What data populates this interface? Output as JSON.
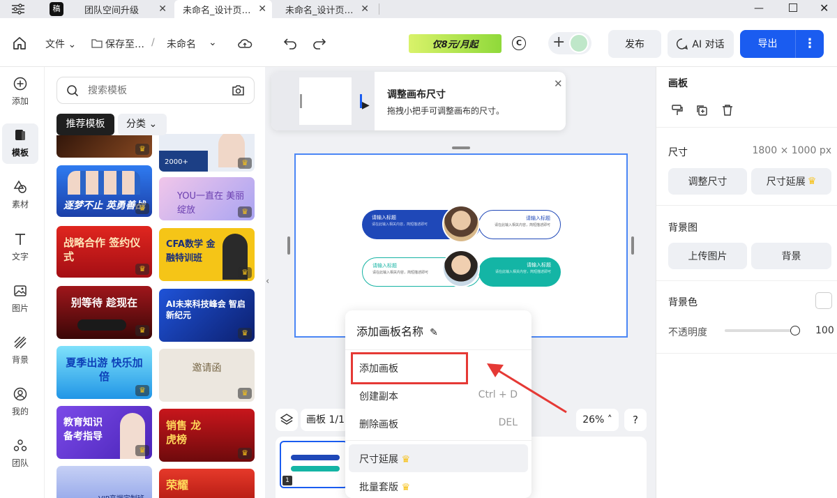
{
  "tabs": [
    {
      "label": "团队空间升级"
    },
    {
      "label": "未命名_设计页…"
    },
    {
      "label": "未命名_设计页…"
    }
  ],
  "toolbar": {
    "file": "文件",
    "save_to": "保存至…",
    "separator": "/",
    "doc_name": "未命名",
    "promo": "仅8元/月起",
    "publish": "发布",
    "ai_chat": "AI 对话",
    "export": "导出"
  },
  "rail": {
    "items": [
      {
        "label": "添加",
        "icon": "plus-circle-icon"
      },
      {
        "label": "模板",
        "icon": "template-icon"
      },
      {
        "label": "素材",
        "icon": "shapes-icon"
      },
      {
        "label": "文字",
        "icon": "text-icon"
      },
      {
        "label": "图片",
        "icon": "image-icon"
      },
      {
        "label": "背景",
        "icon": "background-icon"
      },
      {
        "label": "我的",
        "icon": "user-icon"
      },
      {
        "label": "团队",
        "icon": "team-icon"
      }
    ]
  },
  "templates": {
    "search_placeholder": "搜索模板",
    "tab_recommend": "推荐模板",
    "tab_category": "分类",
    "cards": [
      {
        "title": "",
        "bg": "#5b2a14"
      },
      {
        "title": "2000+",
        "bg": "#e8edf5"
      },
      {
        "title": "逐梦不止 英勇善战",
        "bg": "#2a64c8"
      },
      {
        "title": "YOU一直在 美丽绽放",
        "bg": "#c8b4ee"
      },
      {
        "title": "战略合作 签约仪式",
        "bg": "#c4161c"
      },
      {
        "title": "CFA数学 金融特训班",
        "bg": "#f5c517"
      },
      {
        "title": "别等待 趁现在",
        "bg": "#9c1a1a"
      },
      {
        "title": "AI未来科技峰会 智启新纪元",
        "bg": "#1a3fa8"
      },
      {
        "title": "夏季出游 快乐加倍",
        "bg": "#36b6f0"
      },
      {
        "title": "邀请函",
        "bg": "#ece7df"
      },
      {
        "title": "教育知识 备考指导",
        "bg": "#6a3fd6"
      },
      {
        "title": "销售 龙虎榜",
        "bg": "#b6161a"
      },
      {
        "title": "VIP高端定制班",
        "bg": "#aab9ec"
      },
      {
        "title": "荣耀",
        "bg": "#d42a1e"
      }
    ]
  },
  "tooltip": {
    "title": "调整画布尺寸",
    "desc": "拖拽小把手可调整画布的尺寸。"
  },
  "artboard": {
    "placeholder_title": "请输入标题",
    "placeholder_body": "请在此输入相关内容，简短描述即可"
  },
  "bottom_bar": {
    "page_label": "画板 1/1",
    "zoom": "26%",
    "help": "?",
    "page_number": "1"
  },
  "context_menu": {
    "title": "添加画板名称",
    "items": [
      {
        "label": "添加画板",
        "shortcut": ""
      },
      {
        "label": "创建副本",
        "shortcut": "Ctrl + D"
      },
      {
        "label": "删除画板",
        "shortcut": "DEL"
      },
      {
        "label": "尺寸延展",
        "shortcut": ""
      },
      {
        "label": "批量套版",
        "shortcut": ""
      }
    ]
  },
  "right_panel": {
    "section_title": "画板",
    "size_label": "尺寸",
    "size_value": "1800 × 1000 px",
    "resize_btn": "调整尺寸",
    "extend_btn": "尺寸延展",
    "bg_image_label": "背景图",
    "upload_btn": "上传图片",
    "bg_btn": "背景",
    "bg_color_label": "背景色",
    "opacity_label": "不透明度",
    "opacity_value": "100"
  },
  "colors": {
    "accent": "#1a5cf0",
    "highlight": "#e53935",
    "crown": "#f7c21a"
  }
}
